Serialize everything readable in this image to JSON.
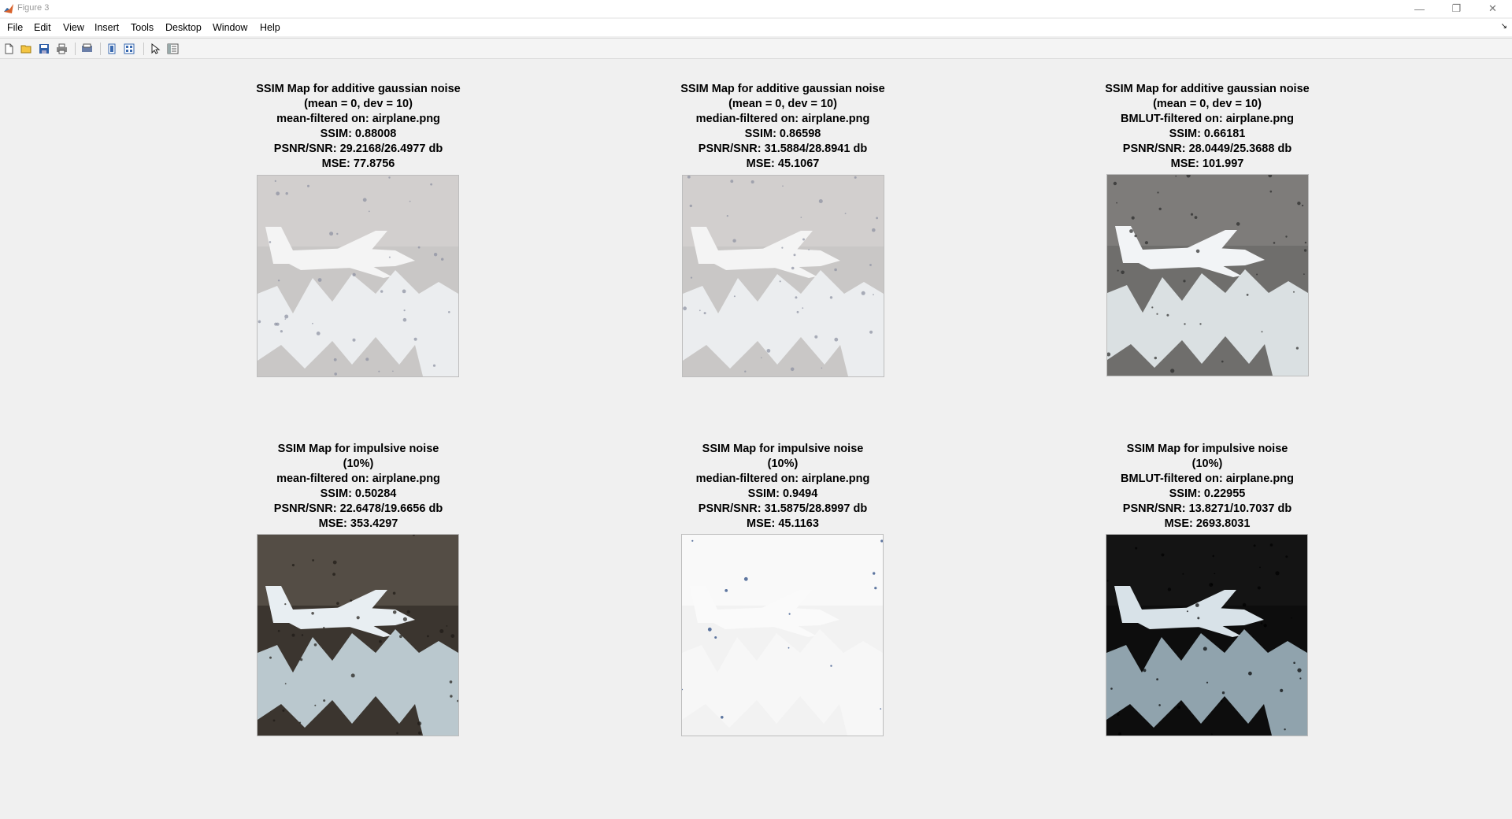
{
  "window": {
    "title": "Figure 3",
    "icon": "matlab-icon"
  },
  "menu": {
    "items": [
      "File",
      "Edit",
      "View",
      "Insert",
      "Tools",
      "Desktop",
      "Window",
      "Help"
    ],
    "dock_arrow": "↘"
  },
  "toolbar": {
    "buttons": [
      "new-figure-icon",
      "open-file-icon",
      "save-icon",
      "print-icon",
      "print-preview-icon",
      "link-plot-icon",
      "insert-colorbar-icon",
      "edit-plot-icon",
      "property-inspector-icon"
    ]
  },
  "panels": [
    {
      "lines": [
        "SSIM Map for additive gaussian noise",
        "(mean = 0, dev = 10)",
        "mean-filtered on: airplane.png",
        "SSIM: 0.88008",
        "PSNR/SNR: 29.2168/26.4977 db",
        "MSE: 77.8756"
      ],
      "tone": "light"
    },
    {
      "lines": [
        "SSIM Map for additive gaussian noise",
        "(mean = 0, dev = 10)",
        "median-filtered on: airplane.png",
        "SSIM: 0.86598",
        "PSNR/SNR: 31.5884/28.8941 db",
        "MSE: 45.1067"
      ],
      "tone": "light"
    },
    {
      "lines": [
        "SSIM Map for additive gaussian noise",
        "(mean = 0, dev = 10)",
        "BMLUT-filtered on: airplane.png",
        "SSIM: 0.66181",
        "PSNR/SNR: 28.0449/25.3688 db",
        "MSE: 101.997"
      ],
      "tone": "mid"
    },
    {
      "lines": [
        "SSIM Map for impulsive noise",
        "(10%)",
        "mean-filtered on: airplane.png",
        "SSIM: 0.50284",
        "PSNR/SNR: 22.6478/19.6656 db",
        "MSE: 353.4297"
      ],
      "tone": "dark"
    },
    {
      "lines": [
        "SSIM Map for impulsive noise",
        "(10%)",
        "median-filtered on: airplane.png",
        "SSIM: 0.9494",
        "PSNR/SNR: 31.5875/28.8997 db",
        "MSE: 45.1163"
      ],
      "tone": "white"
    },
    {
      "lines": [
        "SSIM Map for impulsive noise",
        "(10%)",
        "BMLUT-filtered on: airplane.png",
        "SSIM: 0.22955",
        "PSNR/SNR: 13.8271/10.7037 db",
        "MSE: 2693.8031"
      ],
      "tone": "black"
    }
  ]
}
